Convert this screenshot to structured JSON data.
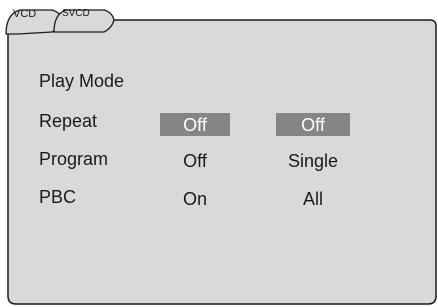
{
  "tabs": [
    {
      "label": "VCD"
    },
    {
      "label": "SVCD"
    }
  ],
  "menu": {
    "title": "Play Mode",
    "rows": [
      {
        "label": "Repeat",
        "values": [
          "Off",
          "Off"
        ]
      },
      {
        "label": "Program",
        "values": [
          "Off",
          "Single"
        ]
      },
      {
        "label": "PBC",
        "values": [
          "On",
          "All"
        ]
      }
    ]
  },
  "colors": {
    "background": "#d9d9d9",
    "selection": "#858585",
    "selected_text": "#ffffff",
    "text": "#1a1a1a"
  }
}
